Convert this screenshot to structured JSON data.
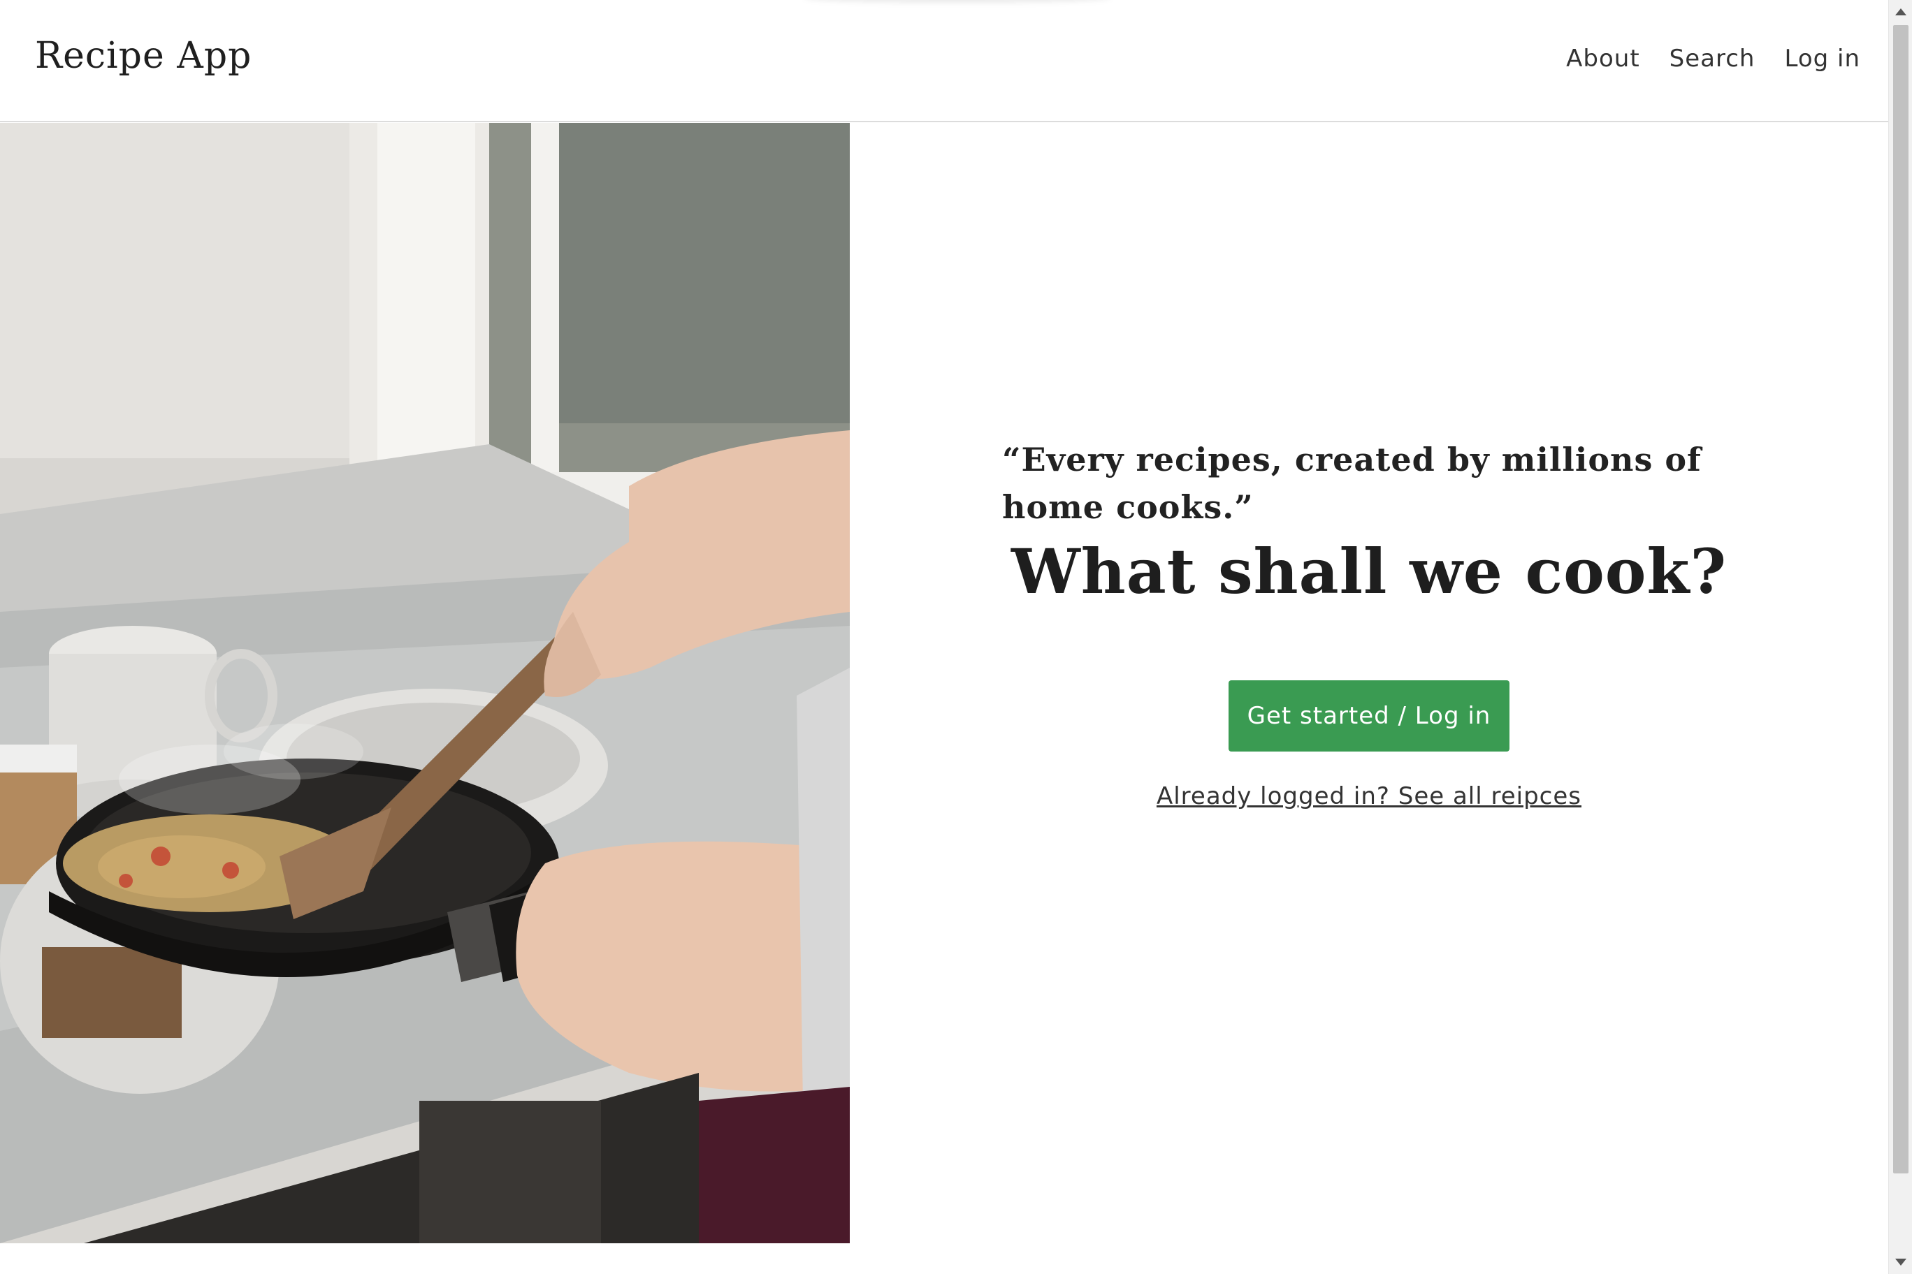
{
  "header": {
    "brand": "Recipe App",
    "nav": [
      {
        "label": "About"
      },
      {
        "label": "Search"
      },
      {
        "label": "Log in"
      }
    ]
  },
  "hero": {
    "image_icon": "photo-icon",
    "quote": "“Every recipes, created by millions of home cooks.”",
    "headline": "What shall we cook?",
    "cta_label": "Get started / Log in",
    "secondary_link": "Already logged in? See all reipces"
  },
  "colors": {
    "accent": "#3a9b52",
    "text": "#222222",
    "background": "#ffffff"
  }
}
